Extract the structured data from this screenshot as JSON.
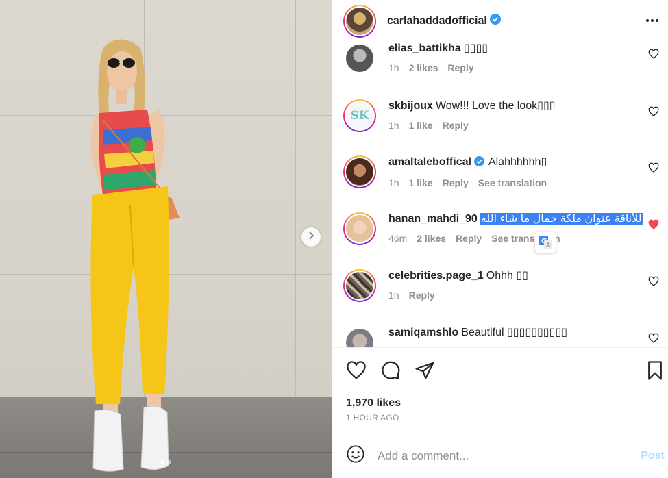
{
  "post": {
    "author": "carlahaddadofficial",
    "likes": "1,970 likes",
    "time": "1 HOUR AGO",
    "carousel_index": 1,
    "carousel_count": 2
  },
  "comments": [
    {
      "user": "elias_battikha",
      "text": "▯▯▯▯",
      "time": "1h",
      "likes": "2 likes",
      "reply": "Reply",
      "translation": "",
      "liked": false
    },
    {
      "user": "skbijoux",
      "text": "Wow!!! Love the look▯▯▯",
      "time": "1h",
      "likes": "1 like",
      "reply": "Reply",
      "translation": "",
      "liked": false
    },
    {
      "user": "amaltaleboffical",
      "text": "Alahhhhhh▯",
      "time": "1h",
      "likes": "1 like",
      "reply": "Reply",
      "translation": "See translation",
      "liked": false
    },
    {
      "user": "hanan_mahdi_90",
      "text": "للأناقة عنوان ملكة جمال ما شاء الله",
      "time": "46m",
      "likes": "2 likes",
      "reply": "Reply",
      "translation": "See translation",
      "liked": true
    },
    {
      "user": "celebrities.page_1",
      "text": "Ohhh ▯▯",
      "time": "1h",
      "likes": "",
      "reply": "Reply",
      "translation": "",
      "liked": false
    },
    {
      "user": "samiqamshlo",
      "text": "Beautiful ▯▯▯▯▯▯▯▯▯▯",
      "time": "",
      "likes": "",
      "reply": "",
      "translation": "",
      "liked": false
    }
  ],
  "composer": {
    "placeholder": "Add a comment...",
    "post_label": "Post"
  },
  "colors": {
    "verified": "#3897f0",
    "liked_heart": "#ed4956",
    "post_disabled": "#b2dffc",
    "selection": "#3b82f6"
  },
  "icons": [
    "more-icon",
    "heart-icon",
    "comment-icon",
    "share-icon",
    "bookmark-icon",
    "emoji-icon",
    "chevron-right-icon",
    "translate-icon",
    "verified-icon"
  ]
}
